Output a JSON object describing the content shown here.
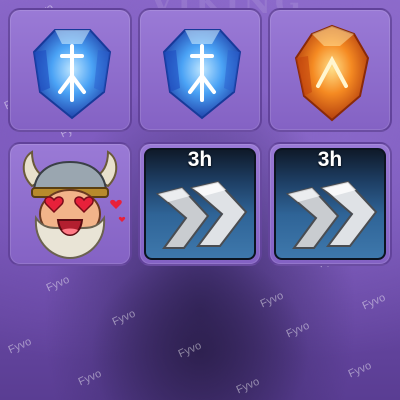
{
  "watermark_text": "Fyvo",
  "inventory": {
    "slots": [
      {
        "item": "blue-rune-gem",
        "icon": "blue-rune-gem-icon",
        "colors": {
          "main": "#3f8ff0",
          "light": "#9fd3ff",
          "dark": "#1c3fa8"
        }
      },
      {
        "item": "blue-rune-gem",
        "icon": "blue-rune-gem-icon",
        "colors": {
          "main": "#3f8ff0",
          "light": "#9fd3ff",
          "dark": "#1c3fa8"
        }
      },
      {
        "item": "orange-rune-gem",
        "icon": "orange-rune-gem-icon",
        "colors": {
          "main": "#f27a1a",
          "light": "#ffd36a",
          "dark": "#b83a0a"
        }
      },
      {
        "item": "viking-love-emote",
        "icon": "viking-emote-icon"
      },
      {
        "item": "speedup",
        "icon": "double-chevron-icon",
        "timer": "3h"
      },
      {
        "item": "speedup",
        "icon": "double-chevron-icon",
        "timer": "3h"
      }
    ]
  },
  "colors": {
    "background": "#7a58b9",
    "slot": "#8e6ccc",
    "speedup_panel": "#2f6497"
  }
}
